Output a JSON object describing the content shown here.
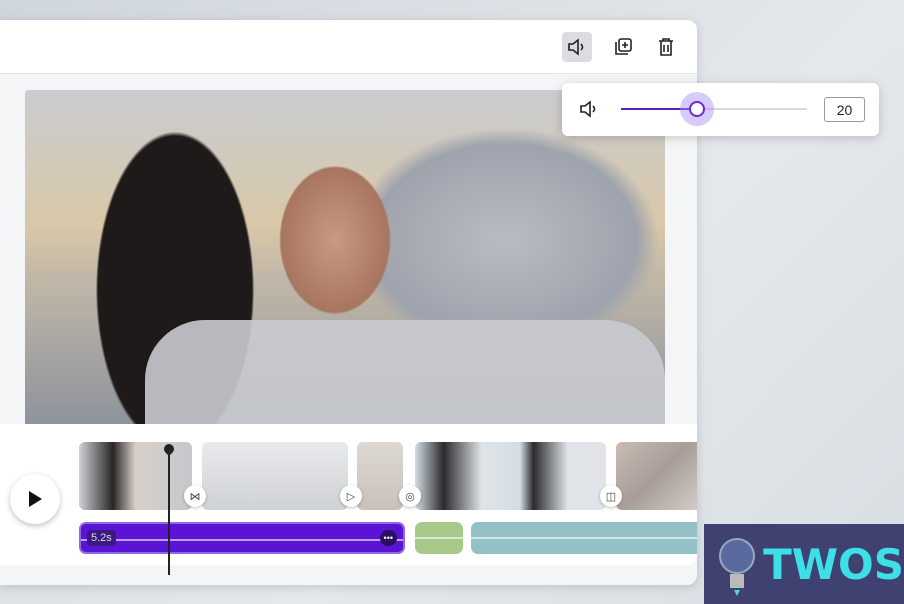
{
  "toolbar": {
    "icons": [
      "speaker-icon",
      "duplicate-icon",
      "trash-icon"
    ]
  },
  "volume_popup": {
    "icon": "speaker-icon",
    "value": "20",
    "slider_fraction": 0.41,
    "accent": "#5b21b6"
  },
  "timeline": {
    "play_icon": "play-icon",
    "transitions": [
      "bowtie-icon",
      "slide-icon",
      "circle-icon",
      "split-icon"
    ],
    "audio_clips": [
      {
        "duration": "5.2s",
        "color": "#5b13d6",
        "more_label": "•••"
      },
      {
        "color": "#a9c98a"
      },
      {
        "color": "#93c1c6"
      }
    ]
  },
  "watermark": {
    "text": "TWOS"
  }
}
